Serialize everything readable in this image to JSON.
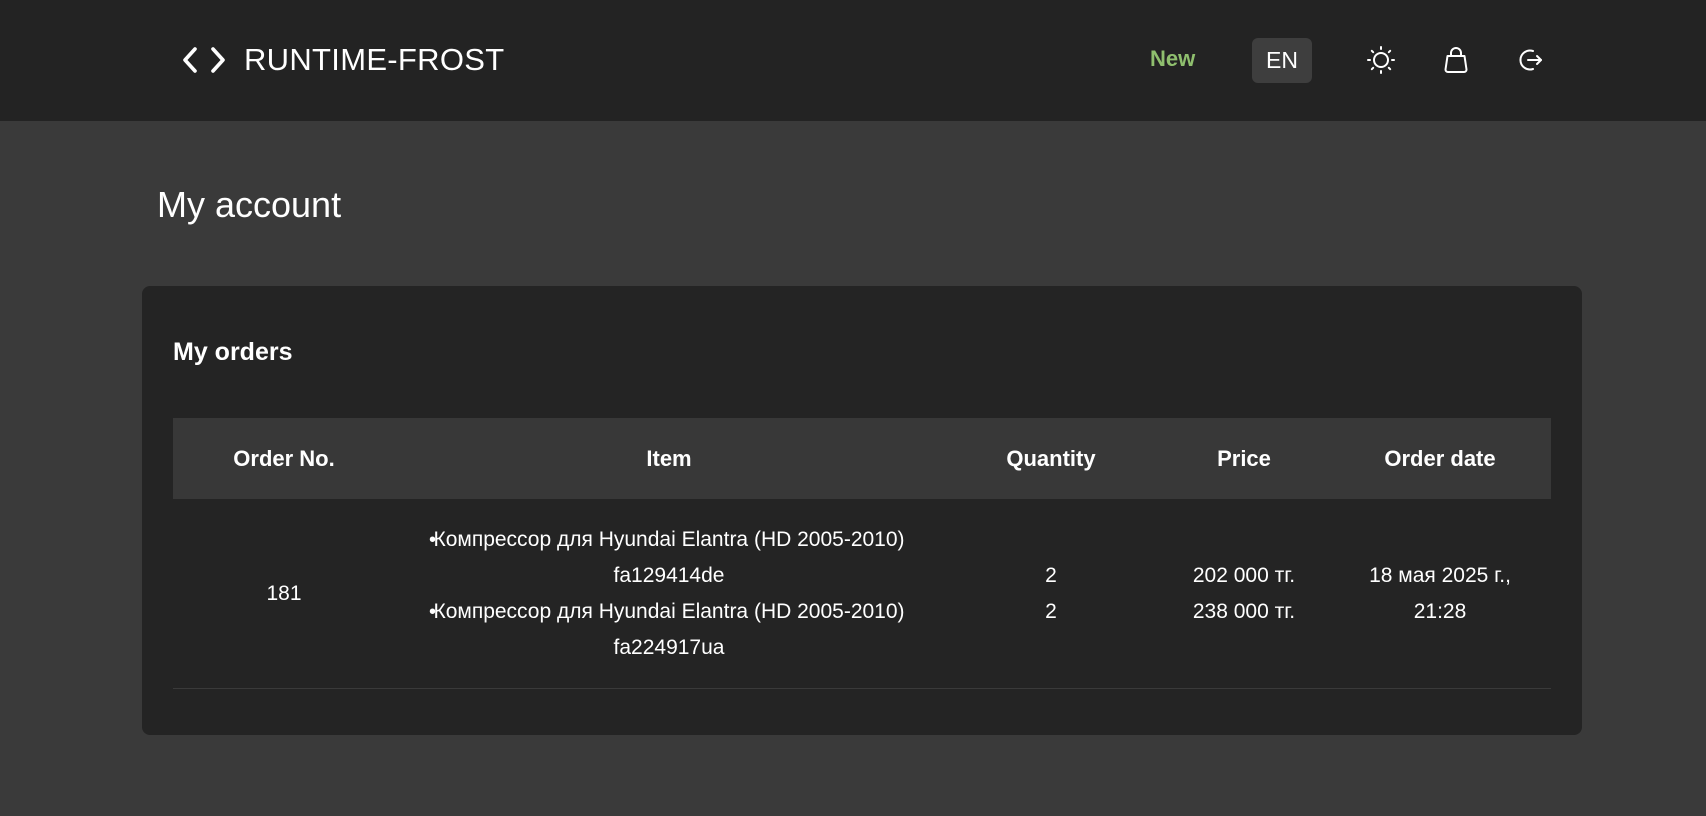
{
  "header": {
    "brand": "RUNTIME-FROST",
    "nav_new": "New",
    "language": "EN"
  },
  "page": {
    "title": "My account"
  },
  "orders": {
    "title": "My orders",
    "columns": [
      "Order No.",
      "Item",
      "Quantity",
      "Price",
      "Order date"
    ],
    "rows": [
      {
        "order_no": "181",
        "items": [
          {
            "name": "Компрессор для Hyundai Elantra (HD 2005-2010)",
            "code": "fa129414de",
            "quantity": "2",
            "price": "202 000 тг."
          },
          {
            "name": "Компрессор для Hyundai Elantra (HD 2005-2010)",
            "code": "fa224917ua",
            "quantity": "2",
            "price": "238 000 тг."
          }
        ],
        "date_line1": "18 мая 2025 г.,",
        "date_line2": "21:28"
      }
    ]
  },
  "colors": {
    "accent_green": "#8fbf6e",
    "header_bg": "#232323",
    "page_bg": "#3a3a3a",
    "card_bg": "#242424"
  },
  "icons": [
    "code-brackets-icon",
    "sun-icon",
    "shopping-bag-icon",
    "logout-icon"
  ]
}
